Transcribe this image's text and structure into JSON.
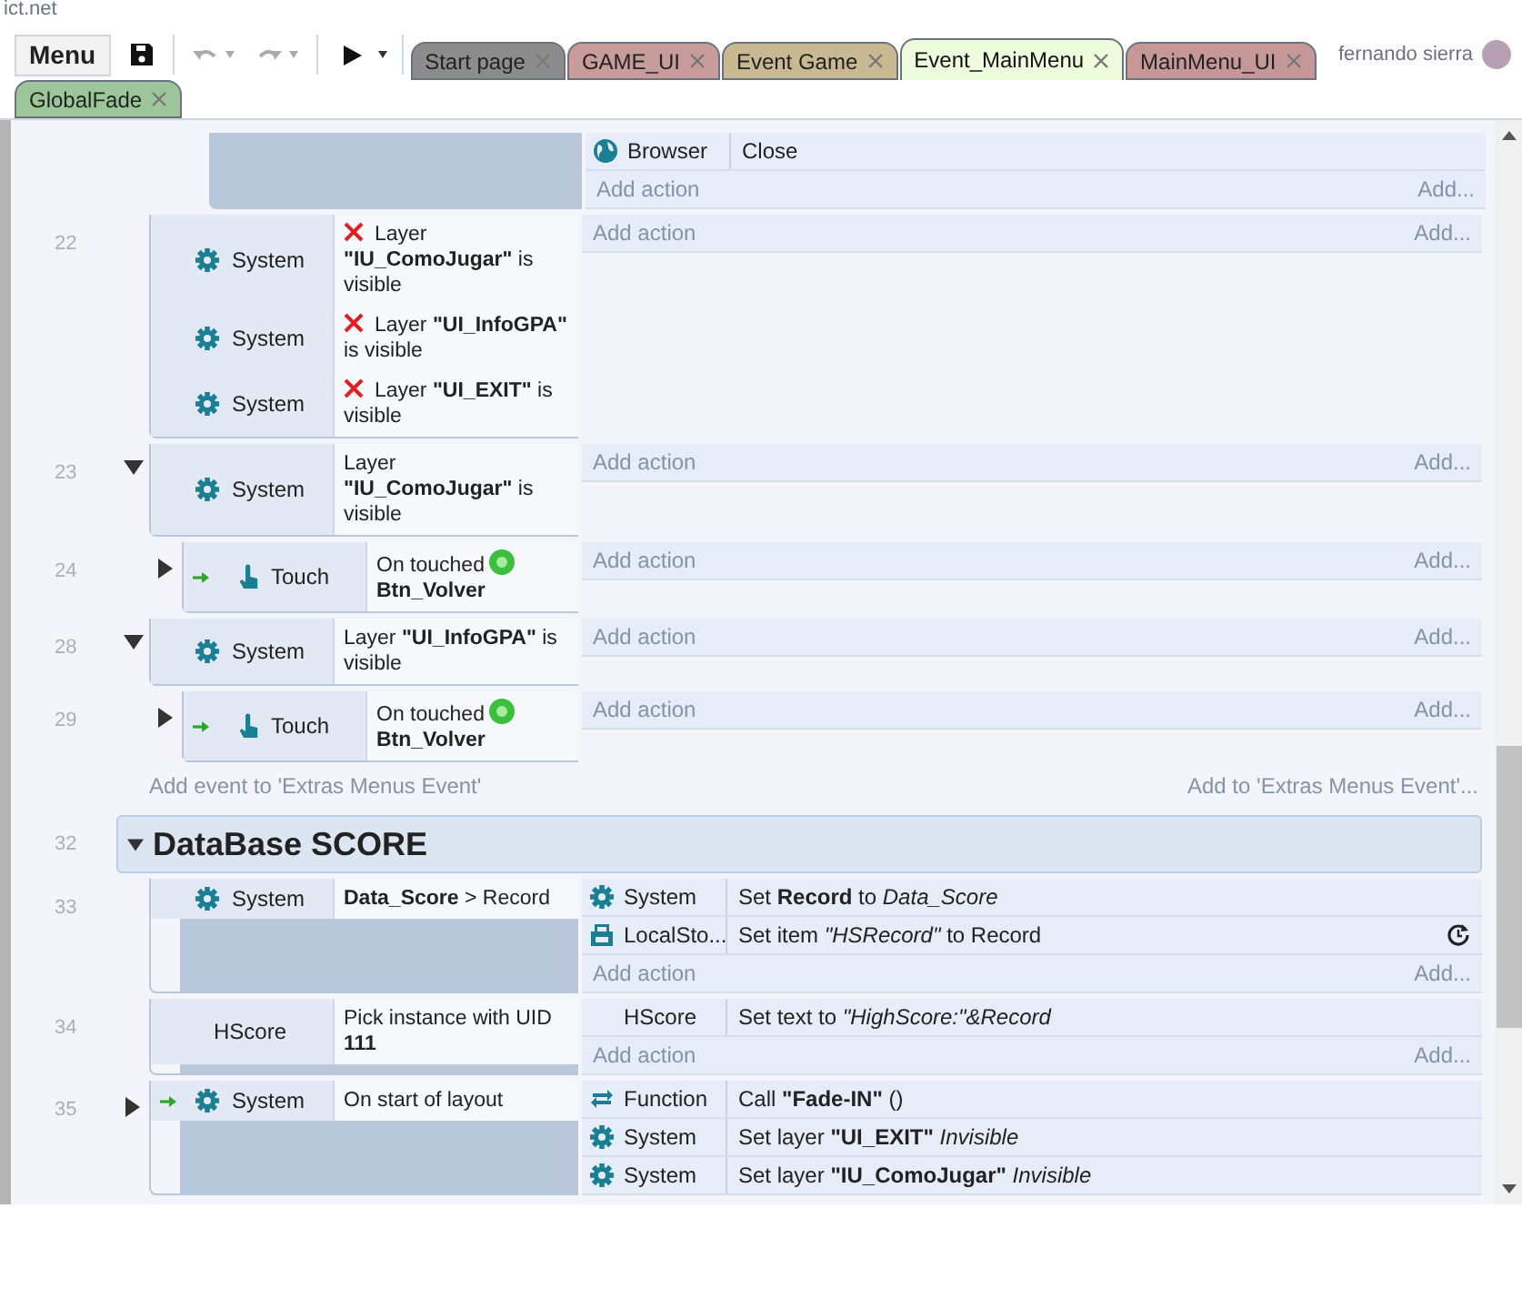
{
  "page_title_fragment": "ict.net",
  "toolbar": {
    "menu_label": "Menu"
  },
  "tabs": [
    {
      "label": "Start page",
      "color": "#8c8c8c",
      "selected": false
    },
    {
      "label": "GAME_UI",
      "color": "#c99c9c",
      "selected": false
    },
    {
      "label": "Event Game",
      "color": "#c8b993",
      "selected": false
    },
    {
      "label": "Event_MainMenu",
      "color": "#ecfcdc",
      "selected": true
    },
    {
      "label": "MainMenu_UI",
      "color": "#c69797",
      "selected": false
    },
    {
      "label": "GlobalFade",
      "color": "#9cc69a",
      "selected": false
    }
  ],
  "user": {
    "name": "fernando sierra"
  },
  "events": [
    {
      "kind": "partial",
      "actions": [
        {
          "object": {
            "kind": "browser",
            "name": "Browser"
          },
          "text": "Close",
          "async": false
        }
      ],
      "add_action": "Add action",
      "add_more": "Add..."
    },
    {
      "kind": "event",
      "number": "22",
      "trigger": false,
      "conditions": [
        {
          "object": {
            "kind": "system",
            "name": "System"
          },
          "inverted": true,
          "badge": false,
          "text": "Layer **\"IU_ComoJugar\"** is visible"
        },
        {
          "object": {
            "kind": "system",
            "name": "System"
          },
          "inverted": true,
          "badge": false,
          "text": "Layer **\"UI_InfoGPA\"** is visible"
        },
        {
          "object": {
            "kind": "system",
            "name": "System"
          },
          "inverted": true,
          "badge": false,
          "text": "Layer **\"UI_EXIT\"** is visible"
        }
      ],
      "add_action": "Add action",
      "add_more": "Add..."
    },
    {
      "kind": "event",
      "number": "23",
      "expanded": true,
      "trigger": false,
      "conditions": [
        {
          "object": {
            "kind": "system",
            "name": "System"
          },
          "inverted": false,
          "badge": false,
          "text": "Layer **\"IU_ComoJugar\"** is visible"
        }
      ],
      "add_action": "Add action",
      "add_more": "Add...",
      "children": [
        {
          "kind": "event",
          "number": "24",
          "expanded": false,
          "trigger": true,
          "conditions": [
            {
              "object": {
                "kind": "touch",
                "name": "Touch"
              },
              "inverted": false,
              "badge": true,
              "text": "On touched",
              "target": "Btn_Volver"
            }
          ],
          "add_action": "Add action",
          "add_more": "Add..."
        }
      ]
    },
    {
      "kind": "event",
      "number": "28",
      "expanded": true,
      "trigger": false,
      "conditions": [
        {
          "object": {
            "kind": "system",
            "name": "System"
          },
          "inverted": false,
          "badge": false,
          "text": "Layer **\"UI_InfoGPA\"** is visible"
        }
      ],
      "add_action": "Add action",
      "add_more": "Add...",
      "children": [
        {
          "kind": "event",
          "number": "29",
          "expanded": false,
          "trigger": true,
          "conditions": [
            {
              "object": {
                "kind": "touch",
                "name": "Touch"
              },
              "inverted": false,
              "badge": true,
              "text": "On touched",
              "target": "Btn_Volver"
            }
          ],
          "add_action": "Add action",
          "add_more": "Add..."
        }
      ]
    },
    {
      "kind": "add_event",
      "text": "Add event to 'Extras Menus Event'",
      "more": "Add to 'Extras Menus Event'..."
    },
    {
      "kind": "group",
      "number": "32",
      "expanded": true,
      "title": "DataBase SCORE",
      "children": [
        {
          "kind": "event",
          "number": "33",
          "trigger": false,
          "conditions": [
            {
              "object": {
                "kind": "system",
                "name": "System"
              },
              "inverted": false,
              "badge": false,
              "text": "**Data_Score** > Record"
            }
          ],
          "actions": [
            {
              "object": {
                "kind": "system",
                "name": "System"
              },
              "text": "Set **Record** to *Data_Score*",
              "async": false
            },
            {
              "object": {
                "kind": "storage",
                "name": "LocalSto..."
              },
              "text": "Set item *\"HSRecord\"* to Record",
              "async": true
            }
          ],
          "add_action": "Add action",
          "add_more": "Add..."
        },
        {
          "kind": "event",
          "number": "34",
          "trigger": false,
          "conditions": [
            {
              "object": {
                "kind": "plain",
                "name": "HScore"
              },
              "inverted": false,
              "badge": false,
              "text": "Pick instance with UID **111**"
            }
          ],
          "actions": [
            {
              "object": {
                "kind": "plain",
                "name": "HScore"
              },
              "text": "Set text to *\"HighScore:\"&Record*",
              "async": false
            }
          ],
          "add_action": "Add action",
          "add_more": "Add..."
        },
        {
          "kind": "event",
          "number": "35",
          "expanded": false,
          "trigger": true,
          "conditions": [
            {
              "object": {
                "kind": "system",
                "name": "System"
              },
              "inverted": false,
              "badge": false,
              "text": "On start of layout"
            }
          ],
          "actions": [
            {
              "object": {
                "kind": "function",
                "name": "Function"
              },
              "text": "Call **\"Fade-IN\"** ()",
              "async": false
            },
            {
              "object": {
                "kind": "system",
                "name": "System"
              },
              "text": "Set layer **\"UI_EXIT\"** *Invisible*",
              "async": false
            },
            {
              "object": {
                "kind": "system",
                "name": "System"
              },
              "text": "Set layer **\"IU_ComoJugar\"** *Invisible*",
              "async": false
            }
          ]
        }
      ]
    }
  ]
}
